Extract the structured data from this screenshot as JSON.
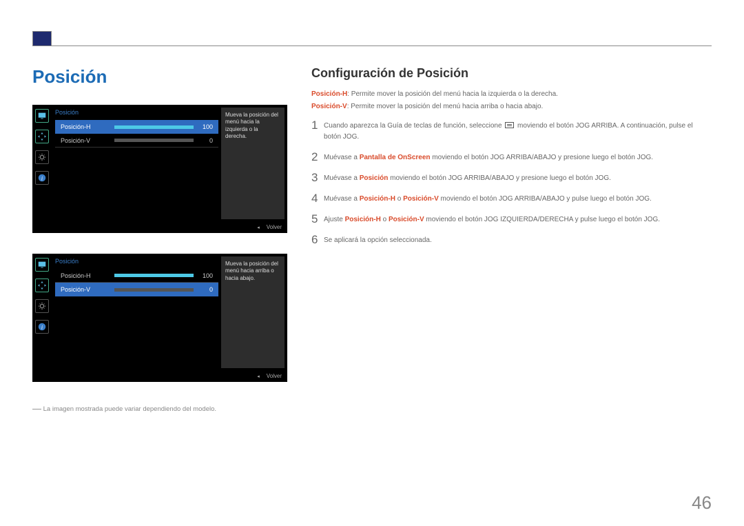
{
  "page_title": "Posición",
  "sub_title": "Configuración de Posición",
  "page_number": "46",
  "desc_h_label": "Posición-H",
  "desc_h_text": ": Permite mover la posición del menú hacia la izquierda o la derecha.",
  "desc_v_label": "Posición-V",
  "desc_v_text": ": Permite mover la posición del menú hacia arriba o hacia abajo.",
  "osd1": {
    "title": "Posición",
    "row_h_label": "Posición-H",
    "row_h_value": "100",
    "row_v_label": "Posición-V",
    "row_v_value": "0",
    "panel_text": "Mueva la posición del menú hacia la izquierda o la derecha.",
    "footer_volver": "Volver"
  },
  "osd2": {
    "title": "Posición",
    "row_h_label": "Posición-H",
    "row_h_value": "100",
    "row_v_label": "Posición-V",
    "row_v_value": "0",
    "panel_text": "Mueva la posición del menú hacia arriba o hacia abajo.",
    "footer_volver": "Volver"
  },
  "osd_sidebar_icons": {
    "display": "display-icon",
    "move": "move-arrows-icon",
    "gear": "gear-icon",
    "info": "info-icon"
  },
  "footnote_dash": "―",
  "footnote_text": "La imagen mostrada puede variar dependiendo del modelo.",
  "steps": {
    "s1_num": "1",
    "s1_a": "Cuando aparezca la Guía de teclas de función, seleccione ",
    "s1_b": " moviendo el botón JOG ARRIBA. A continuación, pulse el botón JOG.",
    "s2_num": "2",
    "s2_a": "Muévase a ",
    "s2_link": "Pantalla de OnScreen",
    "s2_b": " moviendo el botón JOG ARRIBA/ABAJO y presione luego el botón JOG.",
    "s3_num": "3",
    "s3_a": "Muévase a ",
    "s3_link": "Posición",
    "s3_b": " moviendo el botón JOG ARRIBA/ABAJO y presione luego el botón JOG.",
    "s4_num": "4",
    "s4_a": "Muévase a ",
    "s4_linkA": "Posición-H",
    "s4_mid": " o ",
    "s4_linkB": "Posición-V",
    "s4_b": " moviendo el botón JOG ARRIBA/ABAJO y pulse luego el botón JOG.",
    "s5_num": "5",
    "s5_a": "Ajuste ",
    "s5_linkA": "Posición-H",
    "s5_mid": " o ",
    "s5_linkB": "Posición-V",
    "s5_b": " moviendo el botón JOG IZQUIERDA/DERECHA y pulse luego el botón JOG.",
    "s6_num": "6",
    "s6_text": "Se aplicará la opción seleccionada."
  }
}
